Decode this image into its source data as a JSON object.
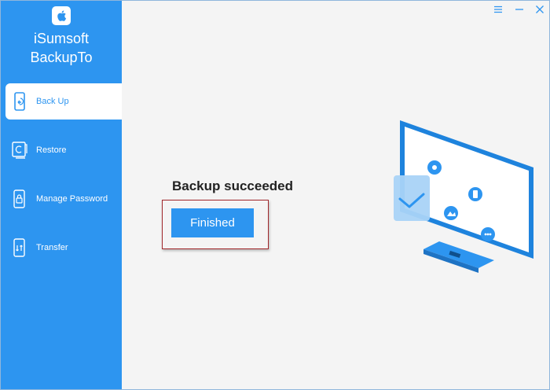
{
  "app": {
    "name_line1": "iSumsoft",
    "name_line2": "BackupTo"
  },
  "sidebar": {
    "items": [
      {
        "label": "Back Up",
        "icon": "phone-backup-icon",
        "active": true
      },
      {
        "label": "Restore",
        "icon": "restore-icon",
        "active": false
      },
      {
        "label": "Manage Password",
        "icon": "password-icon",
        "active": false
      },
      {
        "label": "Transfer",
        "icon": "transfer-icon",
        "active": false
      }
    ]
  },
  "titlebar": {
    "menu_icon": "menu-icon",
    "minimize_icon": "minimize-icon",
    "close_icon": "close-icon"
  },
  "main": {
    "status_text": "Backup succeeded",
    "finish_label": "Finished"
  },
  "colors": {
    "accent": "#2d95f0",
    "highlight_border": "#a0262a"
  }
}
